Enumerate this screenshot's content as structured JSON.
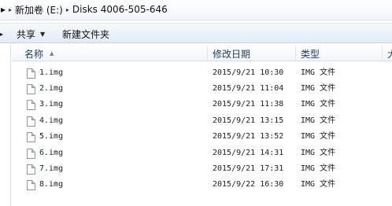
{
  "address": {
    "lead": "▸",
    "drive": "新加卷 (E:)",
    "folder": "Disks 4006-505-646"
  },
  "toolbar": {
    "share_label": "共享",
    "new_folder_label": "新建文件夹"
  },
  "columns": {
    "name": "名称",
    "modified": "修改日期",
    "type": "类型",
    "size": "大"
  },
  "files": [
    {
      "name": "1.img",
      "modified": "2015/9/21 10:30",
      "type": "IMG 文件"
    },
    {
      "name": "2.img",
      "modified": "2015/9/21 11:04",
      "type": "IMG 文件"
    },
    {
      "name": "3.img",
      "modified": "2015/9/21 11:38",
      "type": "IMG 文件"
    },
    {
      "name": "4.img",
      "modified": "2015/9/21 13:15",
      "type": "IMG 文件"
    },
    {
      "name": "5.img",
      "modified": "2015/9/21 13:52",
      "type": "IMG 文件"
    },
    {
      "name": "6.img",
      "modified": "2015/9/21 14:31",
      "type": "IMG 文件"
    },
    {
      "name": "7.img",
      "modified": "2015/9/21 17:31",
      "type": "IMG 文件"
    },
    {
      "name": "8.img",
      "modified": "2015/9/22 16:30",
      "type": "IMG 文件"
    }
  ]
}
